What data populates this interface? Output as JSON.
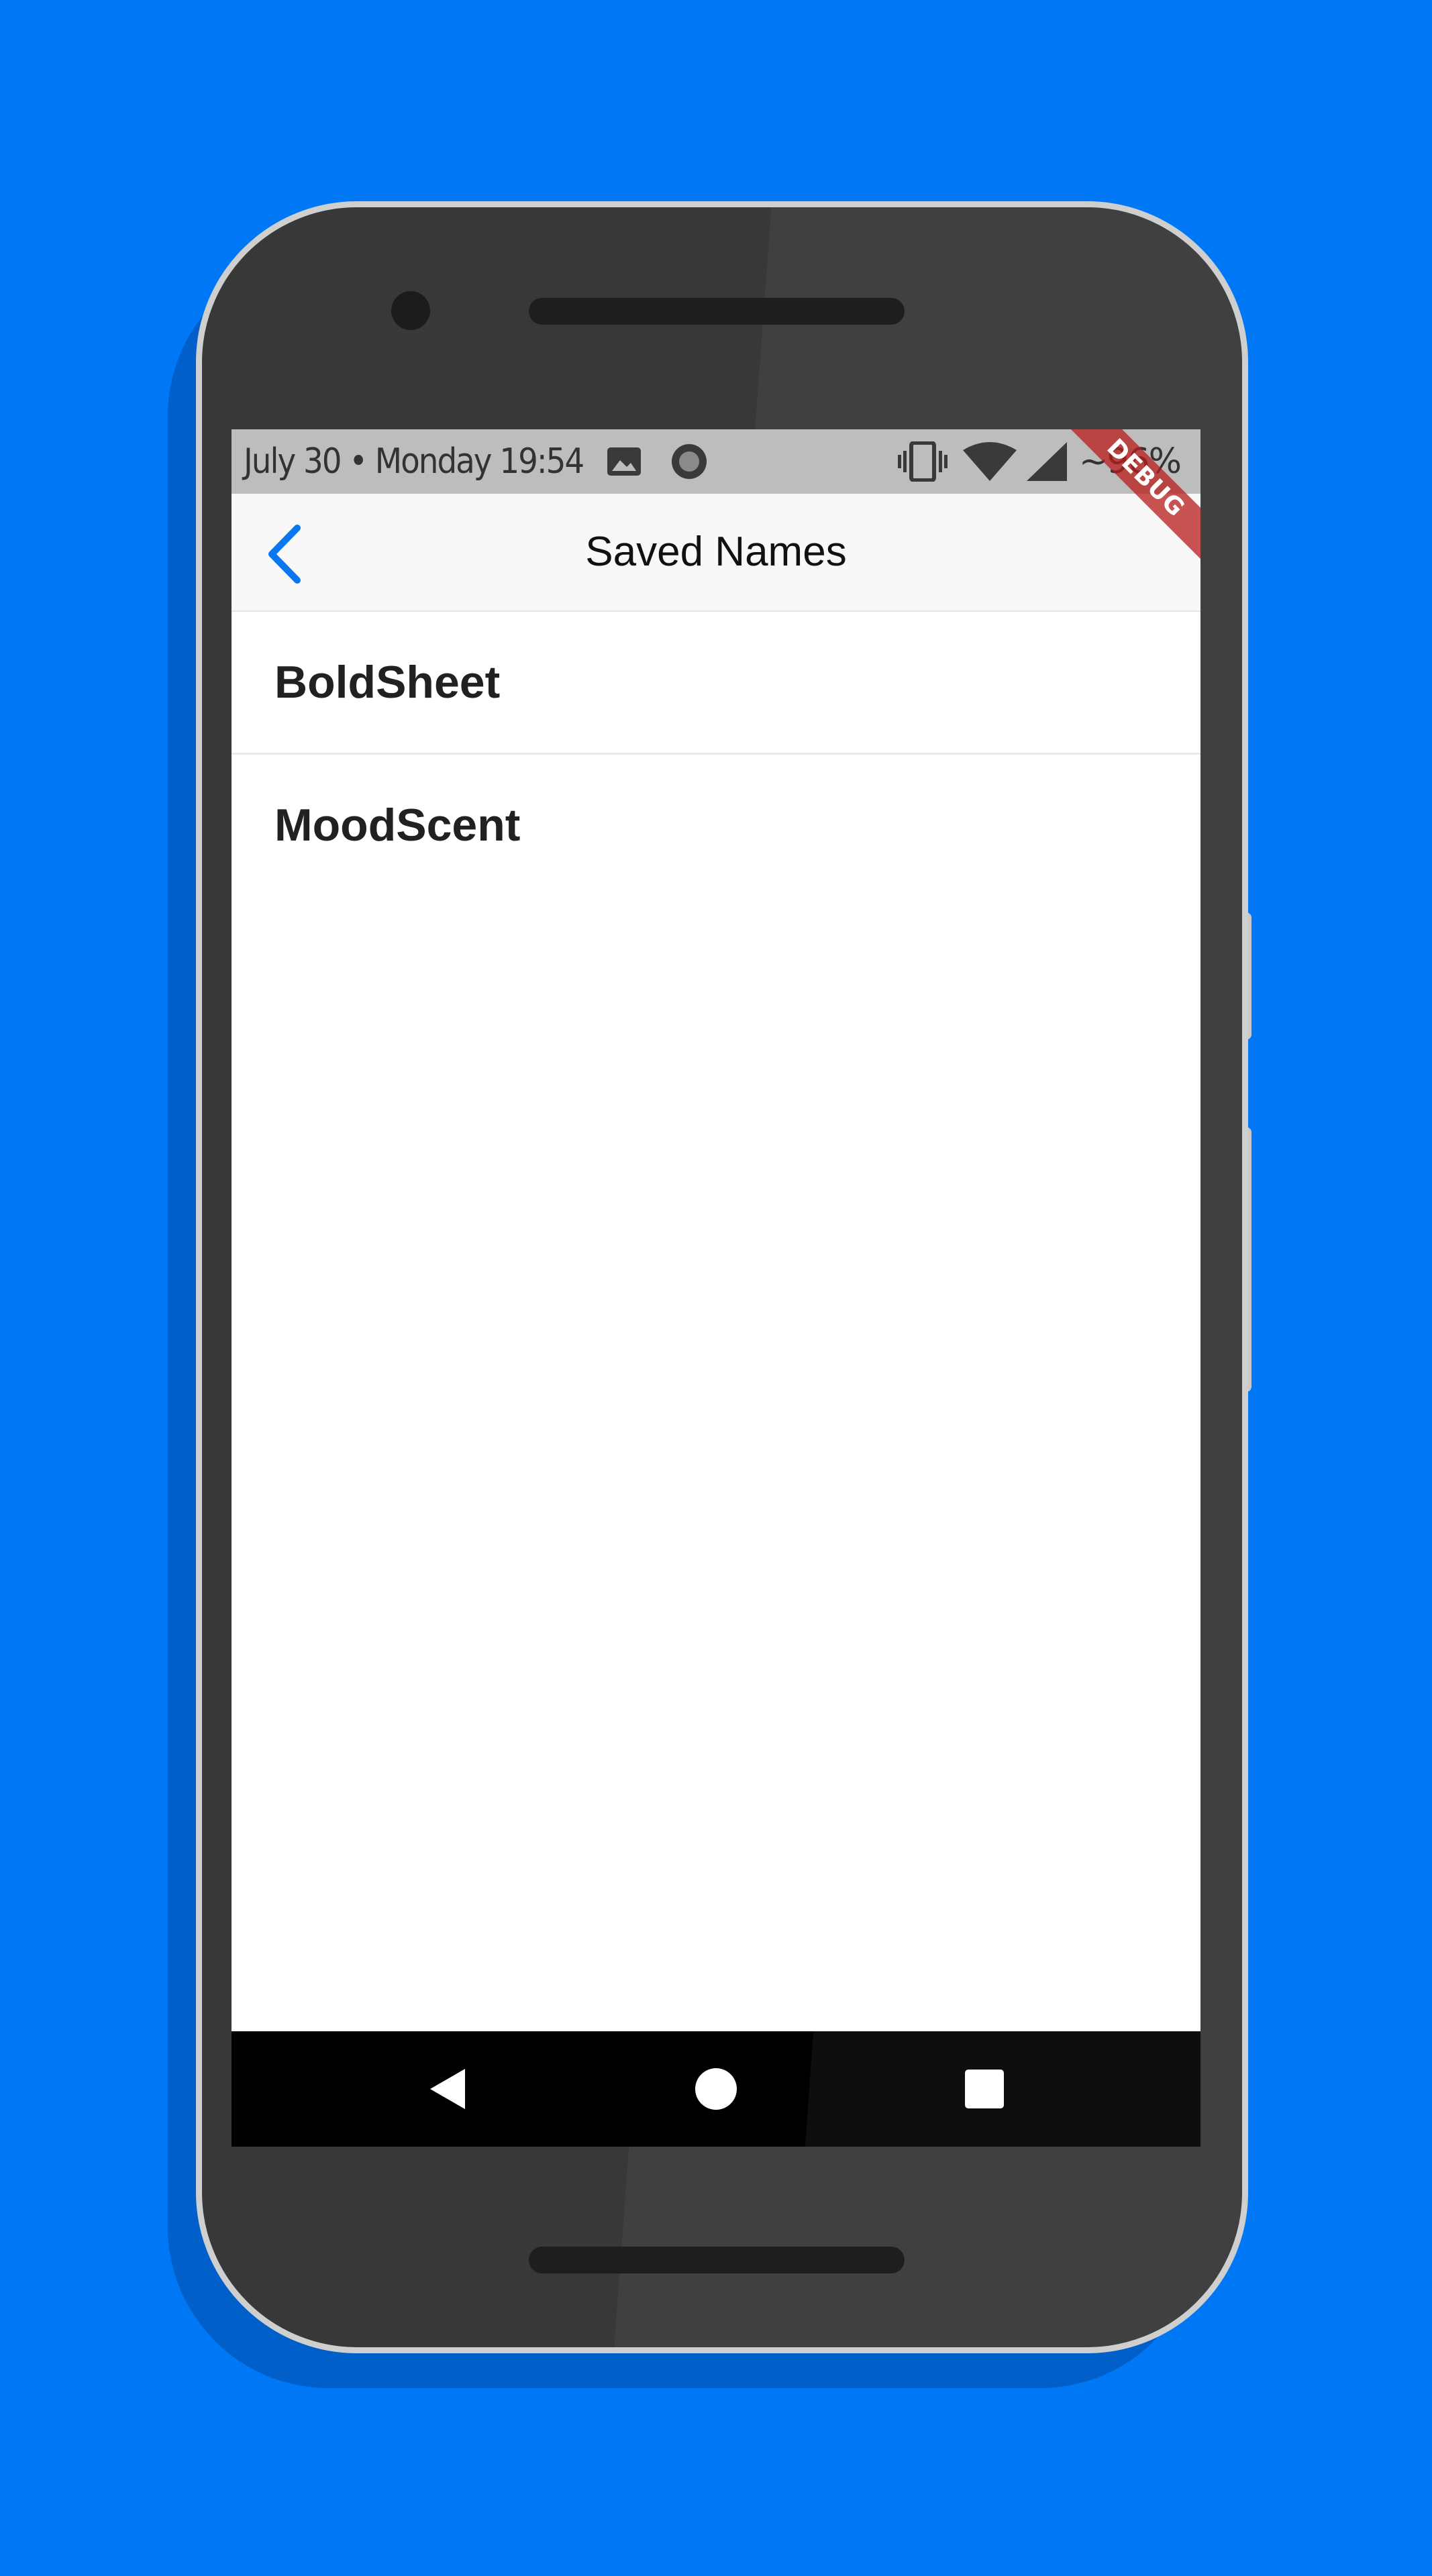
{
  "status_bar": {
    "time": "July 30 • Monday 19:54",
    "battery": "~96%",
    "icons": [
      "image-icon",
      "circle-notification-icon",
      "vibrate-icon",
      "wifi-icon",
      "signal-icon"
    ]
  },
  "app_bar": {
    "title": "Saved Names",
    "back_icon": "chevron-left-icon"
  },
  "saved_names": {
    "items": [
      {
        "label": "BoldSheet"
      },
      {
        "label": "MoodScent"
      }
    ]
  },
  "debug_banner": {
    "label": "DEBUG"
  },
  "nav_bar": {
    "buttons": [
      "back-triangle-icon",
      "home-circle-icon",
      "recents-square-icon"
    ]
  },
  "colors": {
    "background": "#0078f5",
    "accent": "#0a76f0",
    "status_bar": "#bdbdbd",
    "app_bar": "#f8f8f8",
    "debug_ribbon": "#b71c1c"
  }
}
